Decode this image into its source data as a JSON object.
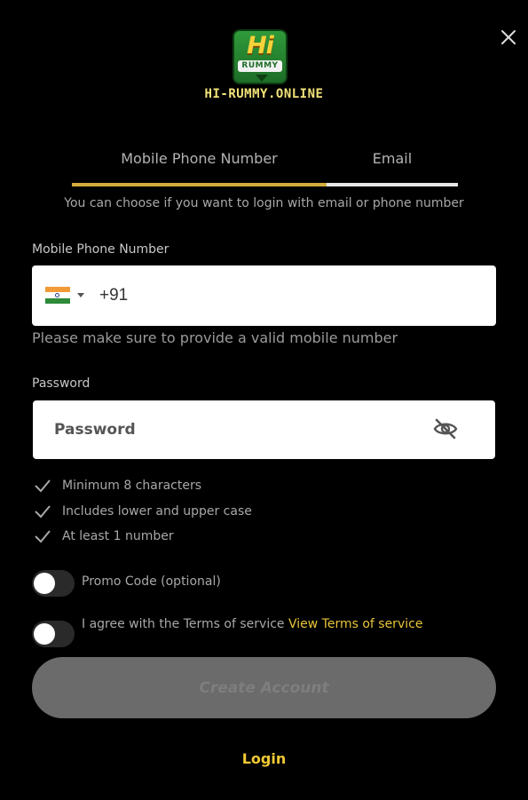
{
  "header": {
    "close_icon": "close-icon",
    "logo": {
      "top": "Hi",
      "bottom": "RUMMY"
    },
    "site_name": "HI-RUMMY.ONLINE"
  },
  "tabs": [
    {
      "label": "Mobile Phone Number",
      "active": true
    },
    {
      "label": "Email",
      "active": false
    }
  ],
  "hint": "You can choose if you want to login with email or phone number",
  "phone": {
    "label": "Mobile Phone Number",
    "country_flag": "india-flag-icon",
    "value": "+91",
    "warning": "Please make sure to provide a valid mobile number"
  },
  "password": {
    "label": "Password",
    "placeholder": "Password",
    "toggle_icon": "eye-off-icon"
  },
  "rules": [
    "Minimum 8 characters",
    "Includes lower and upper case",
    "At least 1 number"
  ],
  "promo": {
    "label": "Promo Code (optional)",
    "on": false
  },
  "terms": {
    "label": "I agree with the Terms of service",
    "link": "View Terms of service",
    "on": false
  },
  "create_button": "Create Account",
  "login_link": "Login",
  "colors": {
    "accent": "#f0c935",
    "tab_active": "#d4ac3e",
    "background": "#000000",
    "button_disabled": "#6b6b6b"
  }
}
